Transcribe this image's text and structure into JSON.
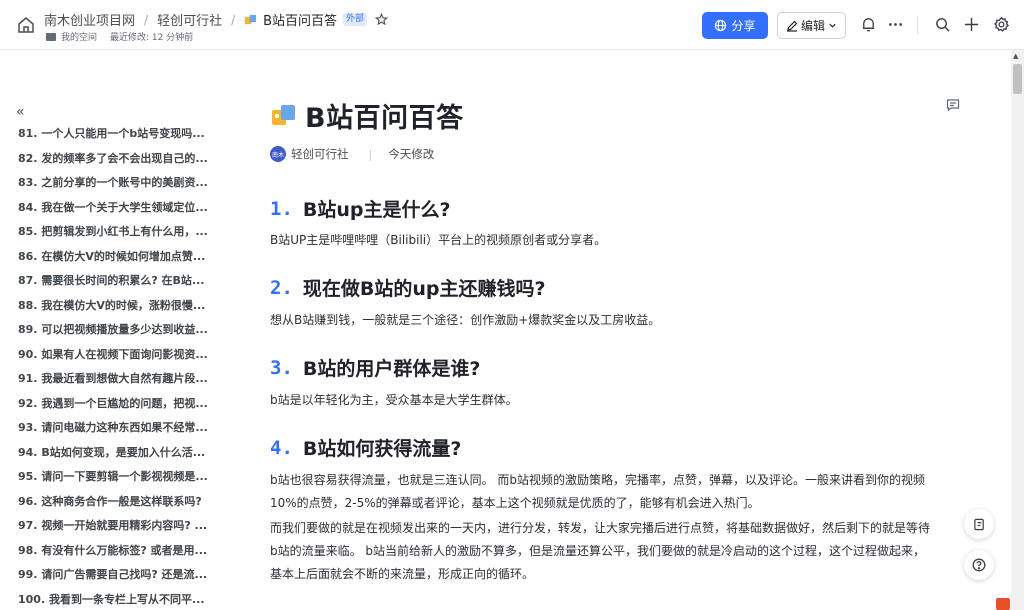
{
  "breadcrumb": {
    "workspace": "南木创业项目网",
    "folder": "轻创可行社",
    "doc_title": "B站百问百答",
    "tag": "外部"
  },
  "meta": {
    "space": "我的空间",
    "modified": "最近修改: 12 分钟前"
  },
  "toolbar": {
    "share_label": "分享",
    "edit_label": "编辑"
  },
  "toc": {
    "items": [
      "81. 一个人只能用一个b站号变现吗...",
      "82. 发的频率多了会不会出现自己的...",
      "83. 之前分享的一个账号中的美剧资...",
      "84. 我在做一个关于大学生领域定位...",
      "85. 把剪辑发到小红书上有什么用，...",
      "86. 在模仿大V的时候如何增加点赞...",
      "87. 需要很长时间的积累么? 在B站...",
      "88. 我在模仿大V的时候，涨粉很慢...",
      "89. 可以把视频播放量多少达到收益...",
      "90. 如果有人在视频下面询问影视资...",
      "91. 我最近看到想做大自然有趣片段...",
      "92. 我遇到一个巨尴尬的问题，把视...",
      "93. 请问电磁力这种东西如果不经常...",
      "94. B站如何变现，是要加入什么活...",
      "95. 请问一下要剪辑一个影视视频是...",
      "96. 这种商务合作一般是这样联系吗?",
      "97. 视频一开始就要用精彩内容吗? ...",
      "98. 有没有什么万能标签? 或者是用...",
      "99. 请问广告需要自己找吗? 还是流...",
      "100. 我看到一条专栏上写从不同平..."
    ]
  },
  "document": {
    "title": "B站百问百答",
    "author": "轻创可行社",
    "author_avatar_text": "南木",
    "modified": "今天修改",
    "sections": [
      {
        "num": "1.",
        "heading": "B站up主是什么?",
        "paras": [
          "B站UP主是哔哩哔哩（Bilibili）平台上的视频原创者或分享者。"
        ]
      },
      {
        "num": "2.",
        "heading": "现在做B站的up主还赚钱吗?",
        "paras": [
          "想从B站赚到钱，一般就是三个途径：创作激励+爆款奖金以及工房收益。"
        ]
      },
      {
        "num": "3.",
        "heading": "B站的用户群体是谁?",
        "paras": [
          "b站是以年轻化为主，受众基本是大学生群体。"
        ]
      },
      {
        "num": "4.",
        "heading": "B站如何获得流量?",
        "paras": [
          "b站也很容易获得流量，也就是三连认同。 而b站视频的激励策略，完播率，点赞，弹幕，以及评论。一般来讲看到你的视频10%的点赞，2-5%的弹幕或者评论，基本上这个视频就是优质的了，能够有机会进入热门。",
          "而我们要做的就是在视频发出来的一天内，进行分发，转发，让大家完播后进行点赞，将基础数据做好，然后剩下的就是等待b站的流量来临。 b站当前给新人的激励不算多，但是流量还算公平，我们要做的就是冷启动的这个过程，这个过程做起来，基本上后面就会不断的来流量，形成正向的循环。"
        ]
      }
    ]
  }
}
